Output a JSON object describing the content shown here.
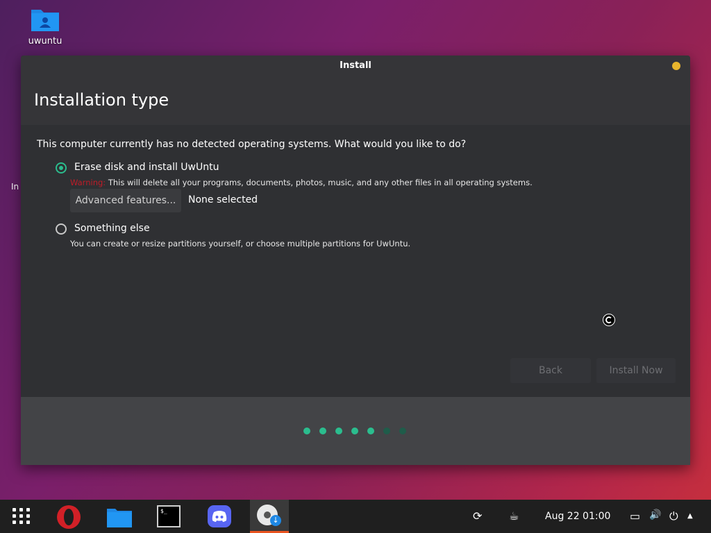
{
  "desktop": {
    "icon_label": "uwuntu",
    "edge_text": "In"
  },
  "window": {
    "title": "Install",
    "header": "Installation type"
  },
  "content": {
    "question": "This computer currently has no detected operating systems. What would you like to do?",
    "options": [
      {
        "label": "Erase disk and install UwUntu",
        "selected": true,
        "warning_label": "Warning:",
        "description": "This will delete all your programs, documents, photos, music, and any other files in all operating systems."
      },
      {
        "label": "Something else",
        "selected": false,
        "description": "You can create or resize partitions yourself, or choose multiple partitions for UwUntu."
      }
    ],
    "advanced_button": "Advanced features...",
    "advanced_status": "None selected"
  },
  "buttons": {
    "back": "Back",
    "install_now": "Install Now"
  },
  "progress": {
    "total_steps": 7,
    "active_steps": 5,
    "active_color": "#2bbd8e",
    "inactive_color": "#1f5c4a"
  },
  "taskbar": {
    "apps": [
      "apps-grid-icon",
      "opera-icon",
      "files-icon",
      "terminal-icon",
      "discord-icon",
      "installer-icon"
    ],
    "terminal_glyph": "$_",
    "installer_badge": "↓",
    "tray": {
      "refresh_glyph": "⟳",
      "coffee_glyph": "☕",
      "clock": "Aug 22  01:00",
      "screen_glyph": "▭",
      "volume_glyph": "🔊",
      "power_glyph": "⏻",
      "menu_glyph": "▲"
    }
  },
  "colors": {
    "accent": "#2bbd8e",
    "title_dot": "#e9b52d",
    "warning": "#c01c28"
  }
}
